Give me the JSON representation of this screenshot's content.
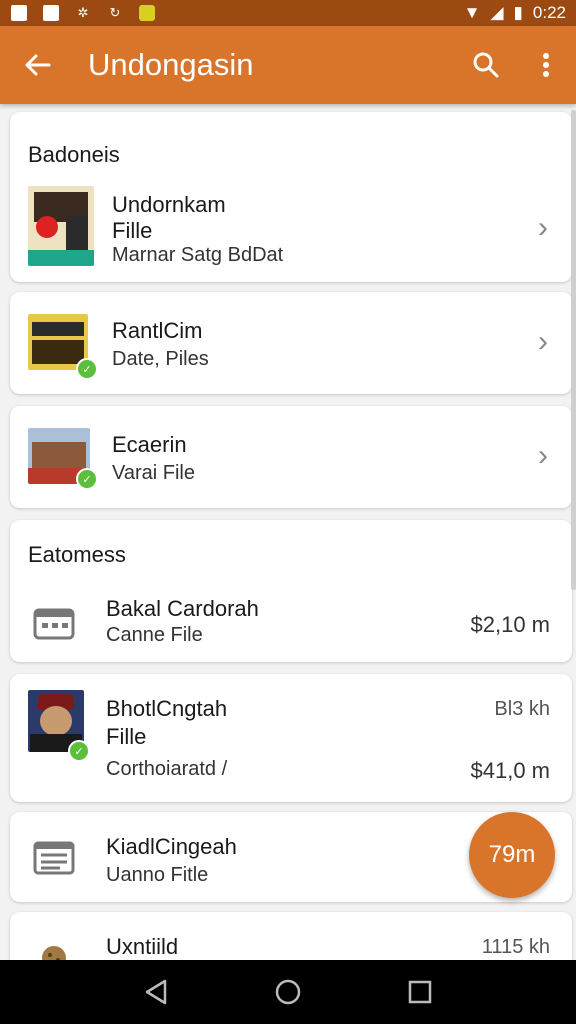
{
  "status_bar": {
    "time": "0:22"
  },
  "app_bar": {
    "title": "Undongasin"
  },
  "sections": {
    "first_heading": "Badoneis",
    "second_heading": "Eatomess"
  },
  "group1": [
    {
      "title": "Undornkam",
      "line2": "Fille",
      "subtitle": "Marnar Satg BdDat"
    },
    {
      "title": "RantlCim",
      "subtitle": "Date, Piles"
    },
    {
      "title": "Ecaerin",
      "subtitle": "Varai File"
    }
  ],
  "group2": [
    {
      "title": "Bakal Cardorah",
      "subtitle": "Canne File",
      "value": "$2,10 m"
    },
    {
      "title": "BhotlCngtah",
      "line2": "Fille",
      "subtitle": "Corthoiaratd /",
      "small": "Bl3 kh",
      "value": "$41,0 m"
    },
    {
      "title": "KiadlCingeah",
      "subtitle": "Uanno Fitle"
    },
    {
      "title": "Uxntiild",
      "small": "1115 kh"
    }
  ],
  "fab": {
    "label": "79m"
  },
  "colors": {
    "accent": "#d9752a",
    "status": "#9c4a12",
    "badge": "#5cbf3c"
  }
}
